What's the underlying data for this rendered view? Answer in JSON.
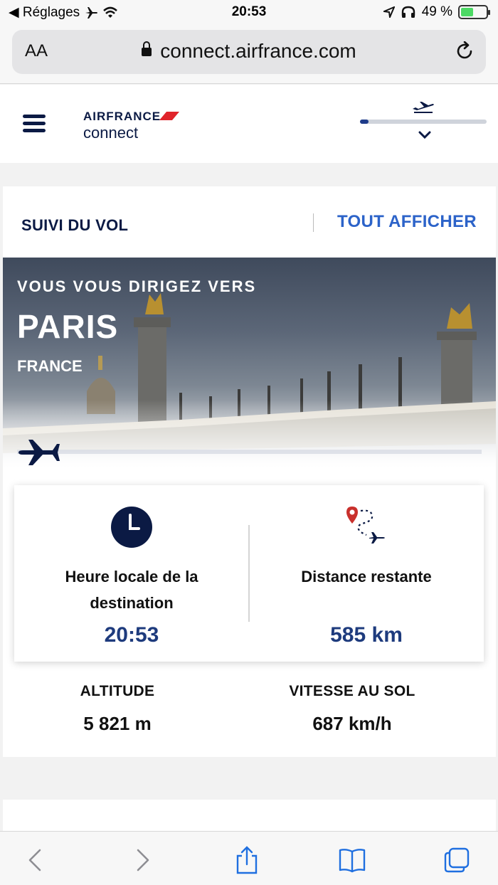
{
  "status_bar": {
    "back_app": "◀ Réglages",
    "time": "20:53",
    "battery": "49 %",
    "battery_level": 0.49
  },
  "browser": {
    "aa_label": "AA",
    "url": "connect.airfrance.com"
  },
  "app_header": {
    "brand_top": "AIRFRANCE",
    "brand_bottom": "connect",
    "flight_progress": 0.07
  },
  "flight_tracking": {
    "title": "SUIVI DU VOL",
    "show_all": "TOUT AFFICHER",
    "heading_to": "VOUS VOUS DIRIGEZ VERS",
    "city": "PARIS",
    "country": "FRANCE",
    "local_time_label": "Heure locale de la destination",
    "local_time_value": "20:53",
    "distance_label": "Distance restante",
    "distance_value": "585 km",
    "altitude_label": "ALTITUDE",
    "altitude_value": "5 821 m",
    "speed_label": "VITESSE AU SOL",
    "speed_value": "687 km/h"
  },
  "colors": {
    "brand_navy": "#0b1a44",
    "accent_blue": "#2c63c9",
    "value_blue": "#1e3b7d",
    "air_france_red": "#e0242b",
    "battery_green": "#4cd964"
  },
  "icons": [
    "airplane-mode-icon",
    "wifi-icon",
    "location-icon",
    "headphones-icon",
    "battery-icon",
    "lock-icon",
    "reload-icon",
    "hamburger-icon",
    "plane-takeoff-icon",
    "chevron-down-icon",
    "plane-icon",
    "clock-icon",
    "route-icon",
    "back-icon",
    "forward-icon",
    "share-icon",
    "bookmarks-icon",
    "tabs-icon"
  ]
}
